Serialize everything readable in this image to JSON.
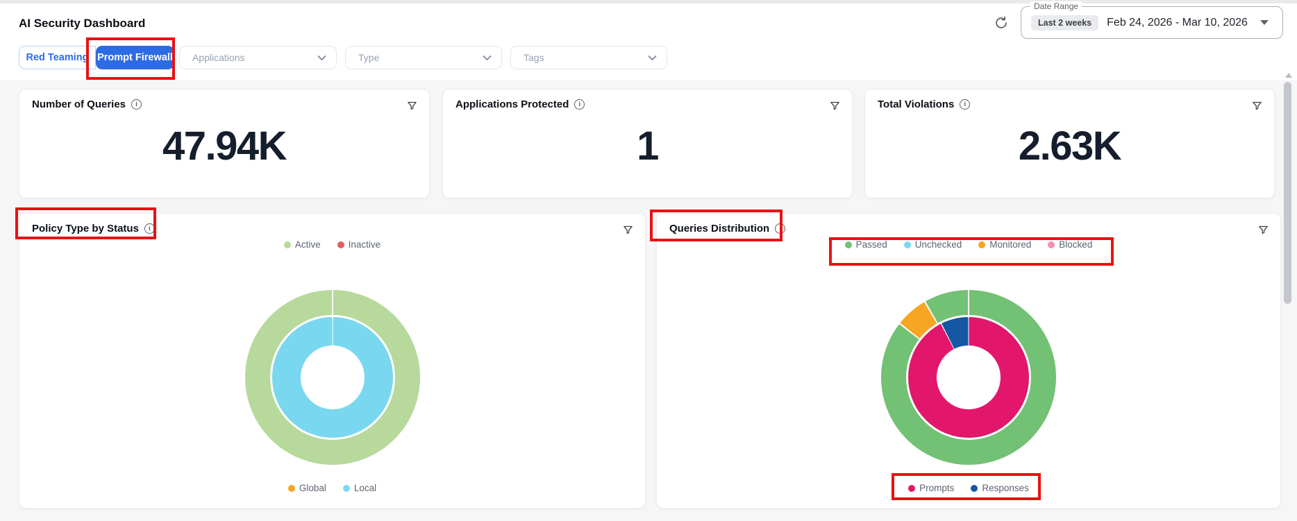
{
  "header": {
    "title": "AI Security Dashboard",
    "date_range": {
      "label": "Date Range",
      "preset": "Last 2 weeks",
      "value": "Feb 24, 2026 - Mar 10, 2026"
    }
  },
  "tabs": [
    {
      "label": "Red Teaming",
      "active": false
    },
    {
      "label": "Prompt Firewall",
      "active": true
    }
  ],
  "filters": [
    {
      "label": "Applications"
    },
    {
      "label": "Type"
    },
    {
      "label": "Tags"
    }
  ],
  "stats": [
    {
      "title": "Number of Queries",
      "value": "47.94K"
    },
    {
      "title": "Applications Protected",
      "value": "1"
    },
    {
      "title": "Total Violations",
      "value": "2.63K"
    }
  ],
  "icons": {
    "info": "i"
  },
  "colors": {
    "accent_blue": "#2d6be4",
    "annotation_red": "#ea1111",
    "value_text": "#141e2c"
  },
  "chart_data": [
    {
      "type": "pie",
      "title": "Policy Type by Status",
      "legend_positions": {
        "top": "status",
        "bottom": "policy_type"
      },
      "rings": [
        {
          "name": "status",
          "legend": "top",
          "slices": [
            {
              "label": "Active",
              "color": "#b7d99b",
              "percent": 100
            },
            {
              "label": "Inactive",
              "color": "#e06060",
              "percent": 0
            }
          ],
          "segments": [
            {
              "label": "Active",
              "color": "#b7d99b",
              "start_deg": 0,
              "end_deg": 360
            }
          ]
        },
        {
          "name": "policy_type",
          "legend": "bottom",
          "slices": [
            {
              "label": "Global",
              "color": "#f6a623",
              "percent": 0
            },
            {
              "label": "Local",
              "color": "#79d8f0",
              "percent": 100
            }
          ],
          "segments": [
            {
              "label": "Local",
              "color": "#79d8f0",
              "start_deg": 0,
              "end_deg": 360
            }
          ]
        }
      ]
    },
    {
      "type": "pie",
      "title": "Queries Distribution",
      "legend_positions": {
        "top": "status",
        "bottom": "source"
      },
      "rings": [
        {
          "name": "status",
          "legend": "top",
          "slices": [
            {
              "label": "Passed",
              "color": "#72c174",
              "percent": 94
            },
            {
              "label": "Unchecked",
              "color": "#79d8f0",
              "percent": 0
            },
            {
              "label": "Monitored",
              "color": "#f6a623",
              "percent": 6
            },
            {
              "label": "Blocked",
              "color": "#f48fb1",
              "percent": 0
            }
          ],
          "segments": [
            {
              "label": "Passed",
              "color": "#72c174",
              "start_deg": 0,
              "end_deg": 308
            },
            {
              "label": "Monitored",
              "color": "#f6a623",
              "start_deg": 308,
              "end_deg": 330
            },
            {
              "label": "Passed",
              "color": "#72c174",
              "start_deg": 330,
              "end_deg": 360
            }
          ]
        },
        {
          "name": "source",
          "legend": "bottom",
          "slices": [
            {
              "label": "Prompts",
              "color": "#e2176b",
              "percent": 92.5
            },
            {
              "label": "Responses",
              "color": "#1458a4",
              "percent": 7.5
            }
          ],
          "segments": [
            {
              "label": "Prompts",
              "color": "#e2176b",
              "start_deg": 0,
              "end_deg": 333
            },
            {
              "label": "Responses",
              "color": "#1458a4",
              "start_deg": 333,
              "end_deg": 360
            }
          ]
        }
      ]
    }
  ]
}
